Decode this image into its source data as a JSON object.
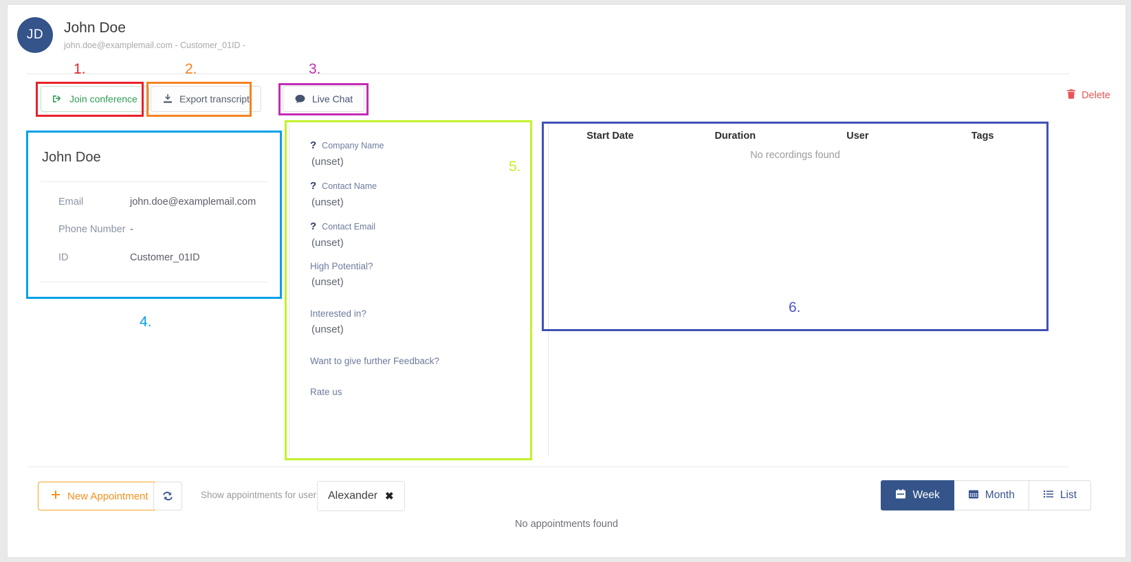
{
  "customer": {
    "initials": "JD",
    "name": "John Doe",
    "subtitle": "john.doe@examplemail.com - Customer_01ID -",
    "avatar_color": "#34548a"
  },
  "actions": {
    "join_conference": "Join conference",
    "export_transcript": "Export transcript",
    "live_chat": "Live Chat",
    "delete": "Delete"
  },
  "annotations": [
    {
      "num": "1.",
      "color": "#e8202a"
    },
    {
      "num": "2.",
      "color": "#f5821f"
    },
    {
      "num": "3.",
      "color": "#c32bb5"
    },
    {
      "num": "4.",
      "color": "#00a0e9"
    },
    {
      "num": "5.",
      "color": "#c2f228"
    },
    {
      "num": "6.",
      "color": "#4b55c8"
    }
  ],
  "customer_card": {
    "title": "John Doe",
    "rows": [
      {
        "label": "Email",
        "value": "john.doe@examplemail.com"
      },
      {
        "label": "Phone Number",
        "value": "-"
      },
      {
        "label": "ID",
        "value": "Customer_01ID"
      }
    ]
  },
  "form": {
    "fields": [
      {
        "marker": "?",
        "label": "Company Name",
        "value": "(unset)"
      },
      {
        "marker": "?",
        "label": "Contact Name",
        "value": "(unset)"
      },
      {
        "marker": "?",
        "label": "Contact Email",
        "value": "(unset)"
      },
      {
        "marker": "",
        "label": "High Potential?",
        "value": "(unset)"
      },
      {
        "marker": "",
        "label": "Interested in?",
        "value": "(unset)"
      },
      {
        "marker": "",
        "label": "Want to give further Feedback?",
        "value": ""
      },
      {
        "marker": "",
        "label": "Rate us",
        "value": ""
      }
    ]
  },
  "recordings": {
    "columns": [
      "Start Date",
      "Duration",
      "User",
      "Tags"
    ],
    "empty_message": "No recordings found",
    "rows": []
  },
  "toolbar": {
    "new_appointment": "New Appointment",
    "refresh_icon": "refresh-icon",
    "show_for_user_label": "Show appointments for user:",
    "selected_user": "Alexander",
    "chip_remove": "✖",
    "views": [
      {
        "label": "Week",
        "active": true
      },
      {
        "label": "Month",
        "active": false
      },
      {
        "label": "List",
        "active": false
      }
    ]
  },
  "appointments": {
    "empty_message": "No appointments found"
  }
}
